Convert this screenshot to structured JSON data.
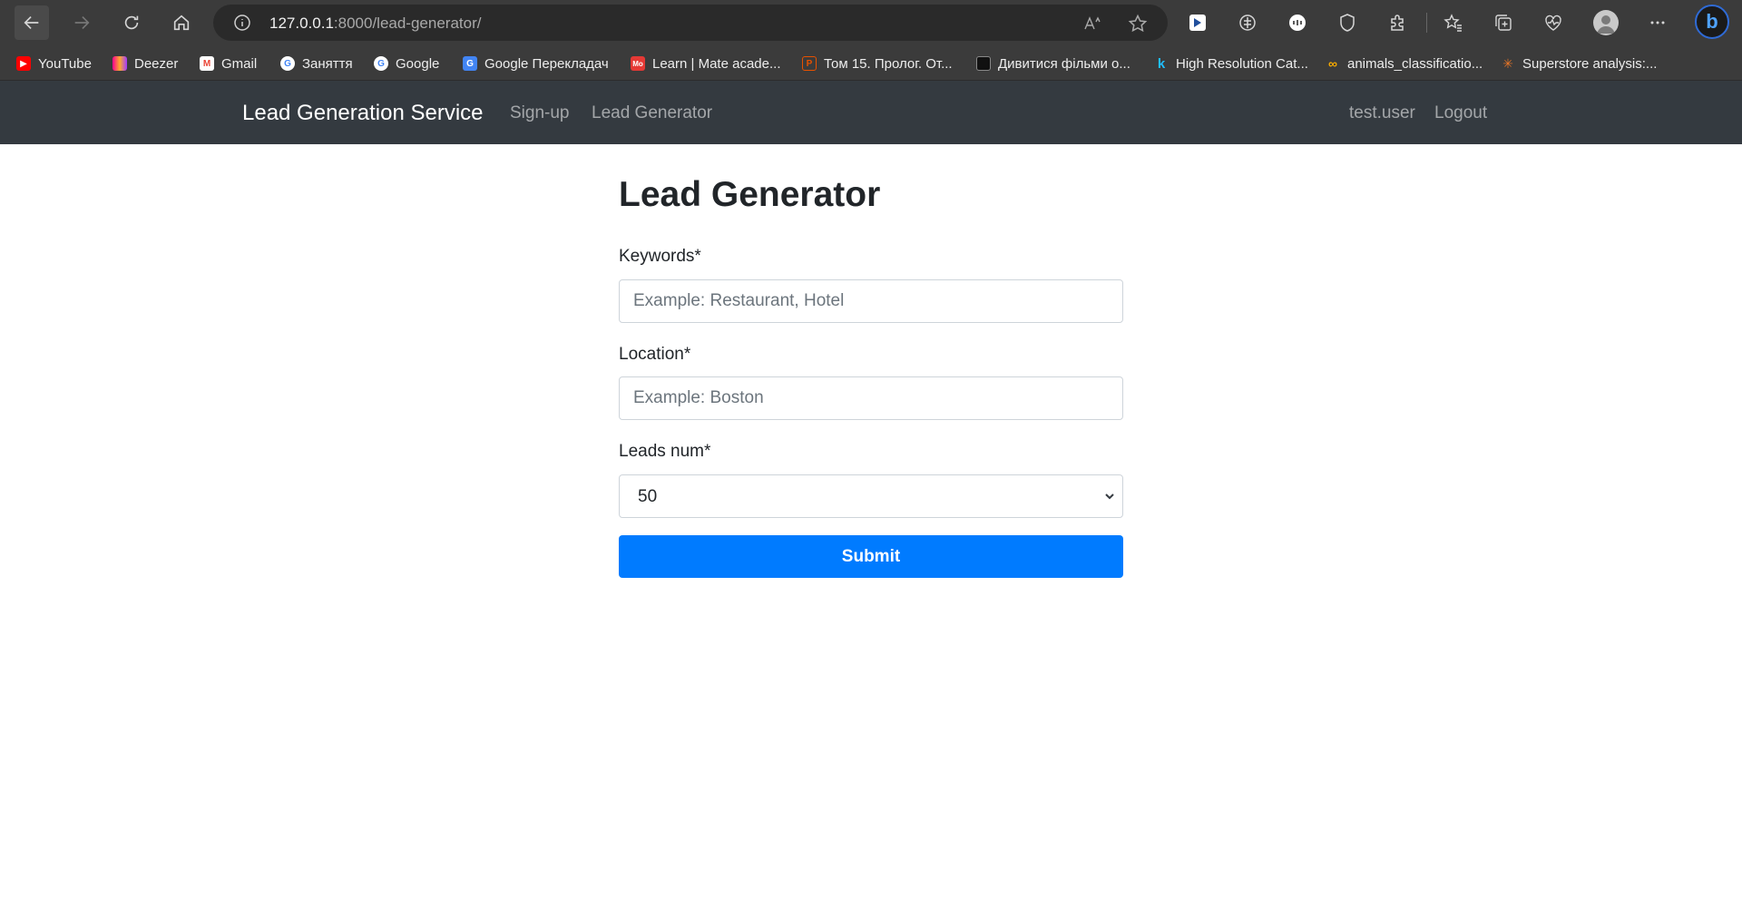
{
  "browser": {
    "url_host": "127.0.0.1",
    "url_rest": ":8000/lead-generator/",
    "bookmarks": [
      {
        "label": "YouTube",
        "icon": "youtube-icon",
        "color": "#ff0000"
      },
      {
        "label": "Deezer",
        "icon": "deezer-icon",
        "color": "#a238ff"
      },
      {
        "label": "Gmail",
        "icon": "gmail-icon",
        "color": "#ea4335"
      },
      {
        "label": "Заняття",
        "icon": "google-icon",
        "color": "#ffffff"
      },
      {
        "label": "Google",
        "icon": "google-icon",
        "color": "#ffffff"
      },
      {
        "label": "Google Перекладач",
        "icon": "translate-icon",
        "color": "#4285f4"
      },
      {
        "label": "Learn | Mate acade...",
        "icon": "mate-icon",
        "color": "#e53935"
      },
      {
        "label": "Том 15. Пролог. От...",
        "icon": "p-icon",
        "color": "#e65100"
      },
      {
        "label": "Дивитися фільми о...",
        "icon": "film-icon",
        "color": "#222222"
      },
      {
        "label": "High Resolution Cat...",
        "icon": "kaggle-icon",
        "color": "#20beff"
      },
      {
        "label": "animals_classificatio...",
        "icon": "colab-icon",
        "color": "#f9ab00"
      },
      {
        "label": "Superstore analysis:...",
        "icon": "tableau-icon",
        "color": "#e97627"
      }
    ]
  },
  "navbar": {
    "brand": "Lead Generation Service",
    "links": [
      "Sign-up",
      "Lead Generator"
    ],
    "user": "test.user",
    "logout": "Logout"
  },
  "form": {
    "title": "Lead Generator",
    "keywords_label": "Keywords*",
    "keywords_placeholder": "Example: Restaurant, Hotel",
    "location_label": "Location*",
    "location_placeholder": "Example: Boston",
    "leads_label": "Leads num*",
    "leads_value": "50",
    "submit_label": "Submit"
  },
  "colors": {
    "navbar": "#343a40",
    "primary": "#007bff"
  }
}
